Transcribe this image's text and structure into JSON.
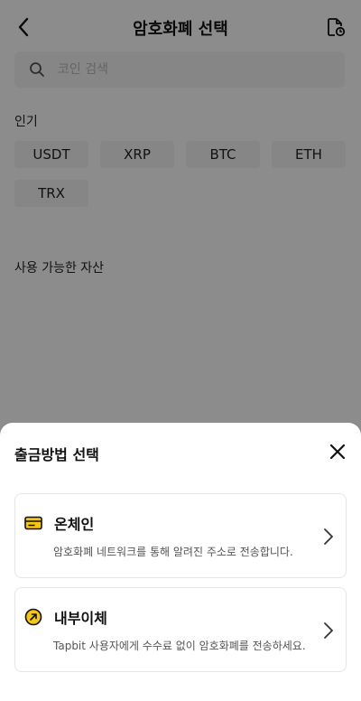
{
  "header": {
    "title": "암호화폐 선택",
    "back_icon": "chevron-left-icon",
    "history_icon": "document-clock-icon"
  },
  "search": {
    "placeholder": "코인 검색",
    "icon": "search-icon"
  },
  "popular": {
    "label": "인기",
    "coins": [
      "USDT",
      "XRP",
      "BTC",
      "ETH",
      "TRX"
    ]
  },
  "assets": {
    "label": "사용 가능한 자산"
  },
  "sheet": {
    "title": "출금방법 선택",
    "close_icon": "close-icon",
    "options": [
      {
        "title": "온체인",
        "description": "암호화폐 네트워크를 통해 알려진 주소로 전송합니다.",
        "icon": "wallet-card-icon"
      },
      {
        "title": "내부이체",
        "description": "Tapbit 사용자에게 수수료 없이 암호화폐를 전송하세요.",
        "icon": "transfer-arrow-icon"
      }
    ]
  },
  "colors": {
    "accent": "#f5c518",
    "overlay": "rgba(0,0,0,0.45)",
    "chip_bg": "#f4f4f4"
  }
}
